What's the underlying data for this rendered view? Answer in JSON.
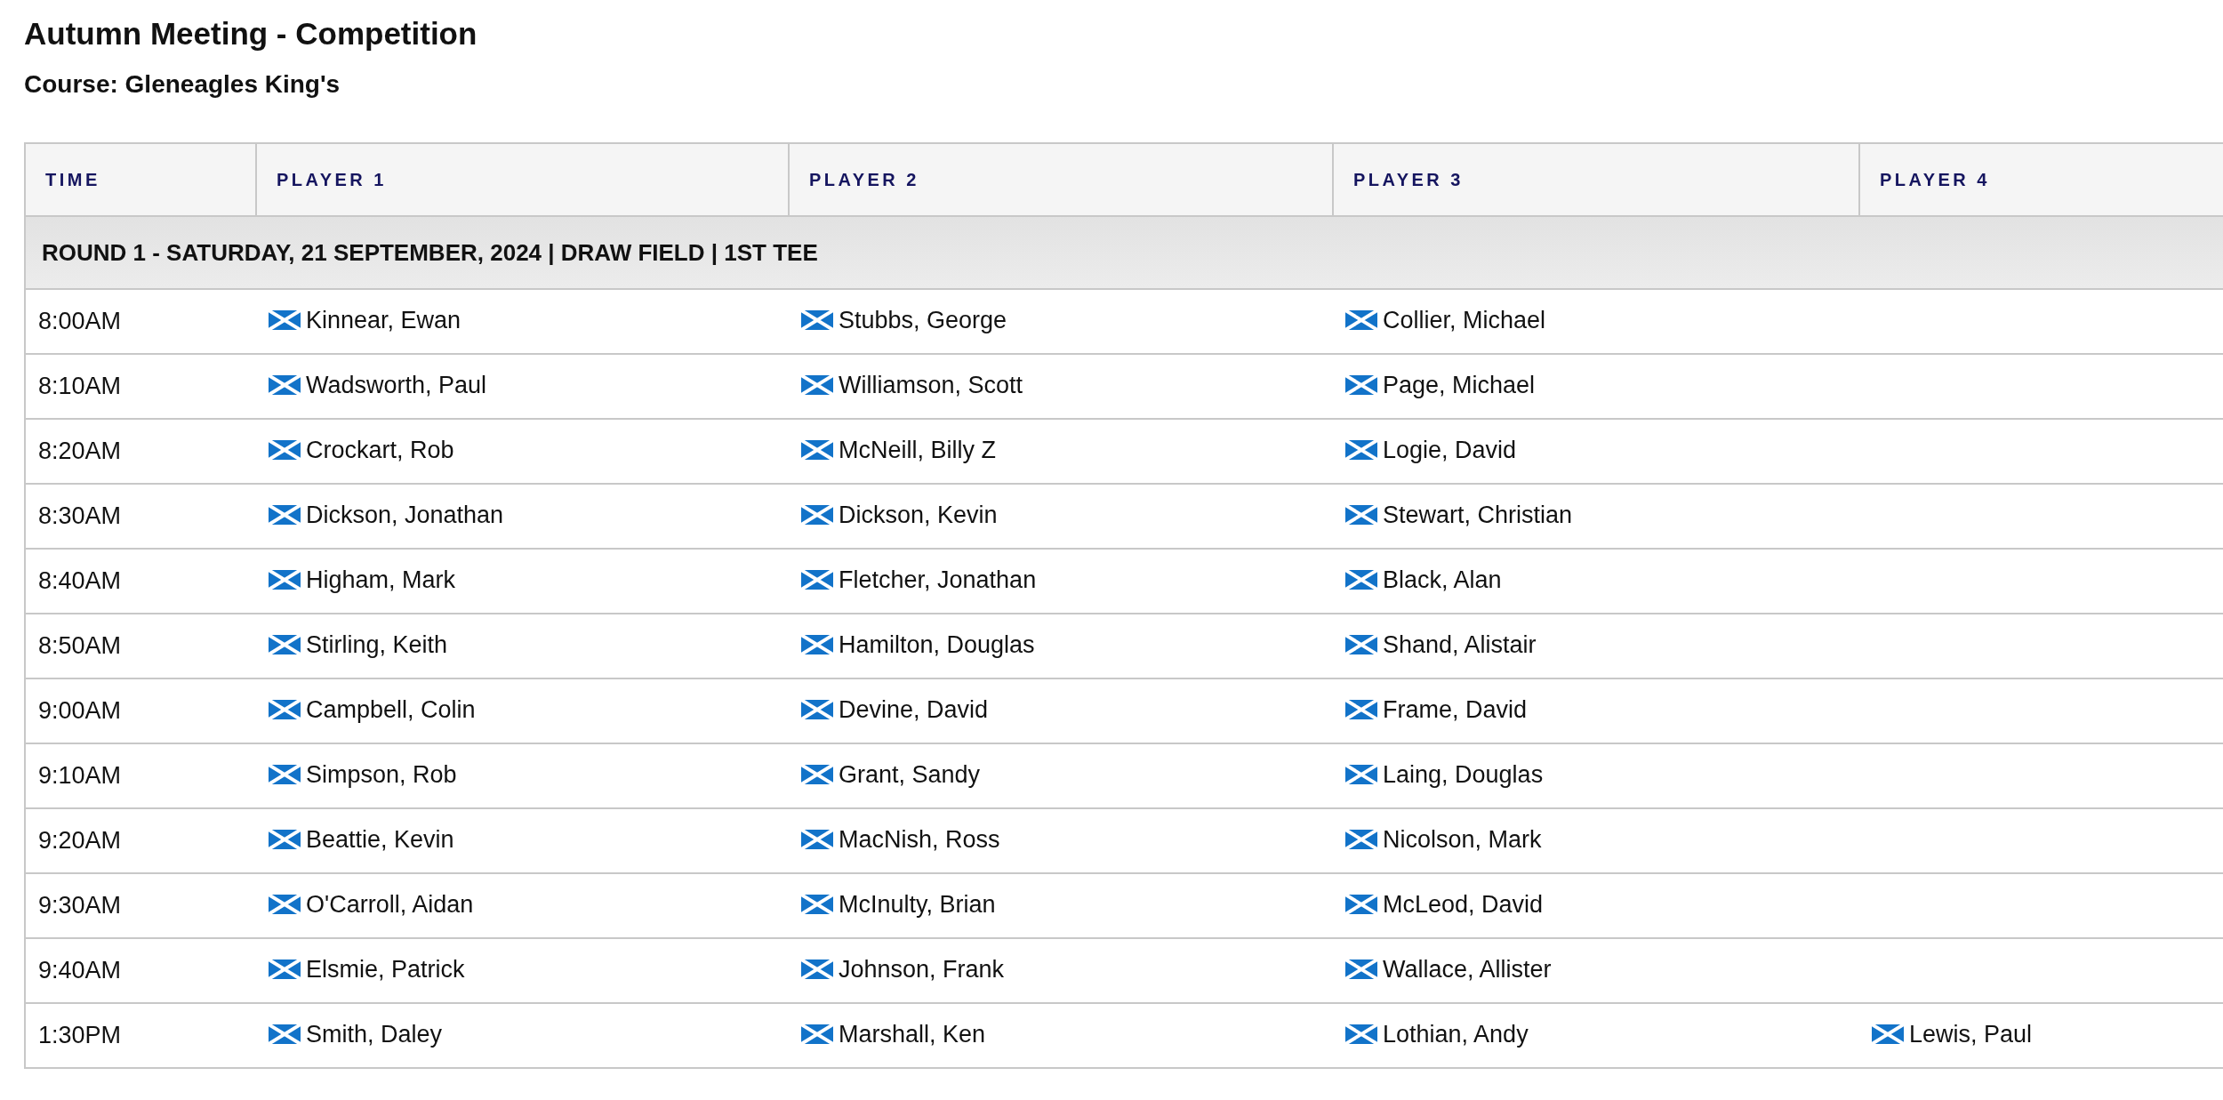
{
  "title": "Autumn Meeting - Competition",
  "course": "Course: Gleneagles King's",
  "table": {
    "columns": [
      "TIME",
      "PLAYER 1",
      "PLAYER 2",
      "PLAYER 3",
      "PLAYER 4"
    ],
    "group_header": "ROUND 1 - SATURDAY, 21 SEPTEMBER, 2024 | DRAW FIELD | 1ST TEE",
    "rows": [
      {
        "time": "8:00AM",
        "players": [
          "Kinnear, Ewan",
          "Stubbs, George",
          "Collier, Michael"
        ]
      },
      {
        "time": "8:10AM",
        "players": [
          "Wadsworth, Paul",
          "Williamson, Scott",
          "Page, Michael"
        ]
      },
      {
        "time": "8:20AM",
        "players": [
          "Crockart, Rob",
          "McNeill, Billy Z",
          "Logie, David"
        ]
      },
      {
        "time": "8:30AM",
        "players": [
          "Dickson, Jonathan",
          "Dickson, Kevin",
          "Stewart, Christian"
        ]
      },
      {
        "time": "8:40AM",
        "players": [
          "Higham, Mark",
          "Fletcher, Jonathan",
          "Black, Alan"
        ]
      },
      {
        "time": "8:50AM",
        "players": [
          "Stirling, Keith",
          "Hamilton, Douglas",
          "Shand, Alistair"
        ]
      },
      {
        "time": "9:00AM",
        "players": [
          "Campbell, Colin",
          "Devine, David",
          "Frame, David"
        ]
      },
      {
        "time": "9:10AM",
        "players": [
          "Simpson, Rob",
          "Grant, Sandy",
          "Laing, Douglas"
        ]
      },
      {
        "time": "9:20AM",
        "players": [
          "Beattie, Kevin",
          "MacNish, Ross",
          "Nicolson, Mark"
        ]
      },
      {
        "time": "9:30AM",
        "players": [
          "O'Carroll, Aidan",
          "McInulty, Brian",
          "McLeod, David"
        ]
      },
      {
        "time": "9:40AM",
        "players": [
          "Elsmie, Patrick",
          "Johnson, Frank",
          "Wallace, Allister"
        ]
      },
      {
        "time": "1:30PM",
        "players": [
          "Smith, Daley",
          "Marshall, Ken",
          "Lothian, Andy",
          "Lewis, Paul"
        ]
      }
    ]
  }
}
